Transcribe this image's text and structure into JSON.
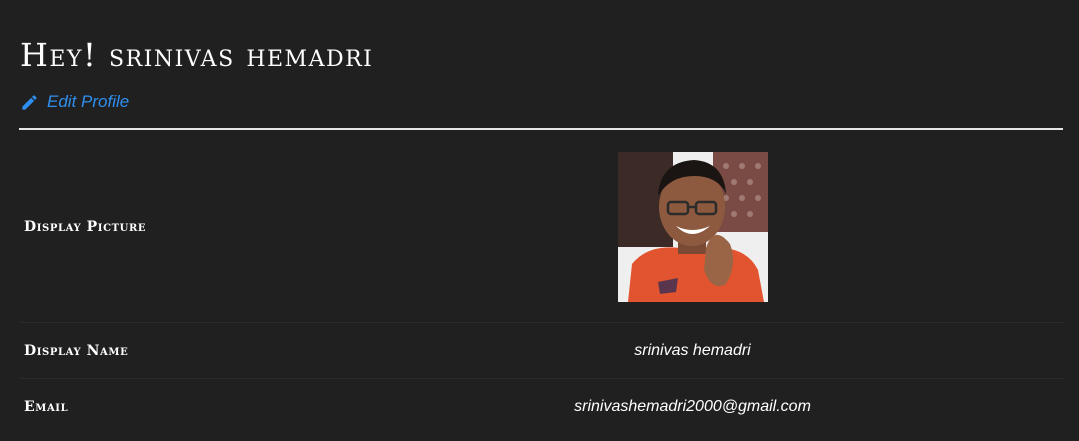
{
  "header": {
    "greeting": "Hey! srinivas hemadri",
    "edit_label": "Edit Profile",
    "edit_icon": "pencil-icon",
    "accent_color": "#2f8ff0"
  },
  "profile": {
    "picture_label": "Display Picture",
    "name_label": "Display Name",
    "name_value": "srinivas hemadri",
    "email_label": "Email",
    "email_value": "srinivashemadri2000@gmail.com"
  },
  "colors": {
    "background": "#202020",
    "text": "#ffffff",
    "divider": "#e6e6e6"
  }
}
